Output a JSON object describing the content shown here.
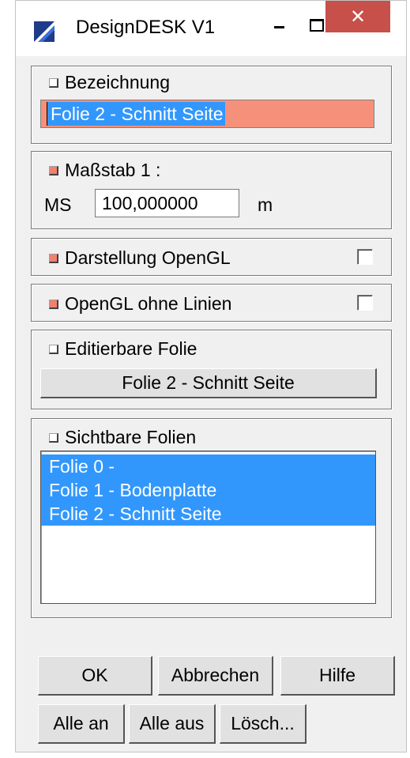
{
  "window": {
    "title": "DesignDESK V1",
    "close_glyph": "✕",
    "accent_close": "#c7504a"
  },
  "bezeichnung": {
    "label": "Bezeichnung",
    "value": "Folie 2 - Schnitt Seite",
    "field_color": "#f5917a"
  },
  "massstab": {
    "label": "Maßstab  1 :",
    "ms_label": "MS",
    "value": "100,000000",
    "unit": "m"
  },
  "opengl": {
    "label": "Darstellung OpenGL",
    "checked": false
  },
  "opengl_lines": {
    "label": "OpenGL ohne Linien",
    "checked": false
  },
  "editable": {
    "label": "Editierbare Folie",
    "button_label": "Folie 2 - Schnitt Seite"
  },
  "visible": {
    "label": "Sichtbare Folien",
    "items": [
      {
        "label": "Folie 0 -",
        "selected": true
      },
      {
        "label": "Folie 1 - Bodenplatte",
        "selected": true
      },
      {
        "label": "Folie 2 - Schnitt Seite",
        "selected": true
      }
    ],
    "selection_color": "#3297fd"
  },
  "buttons": {
    "ok": "OK",
    "cancel": "Abbrechen",
    "help": "Hilfe",
    "all_on": "Alle an",
    "all_off": "Alle aus",
    "delete": "Lösch..."
  }
}
